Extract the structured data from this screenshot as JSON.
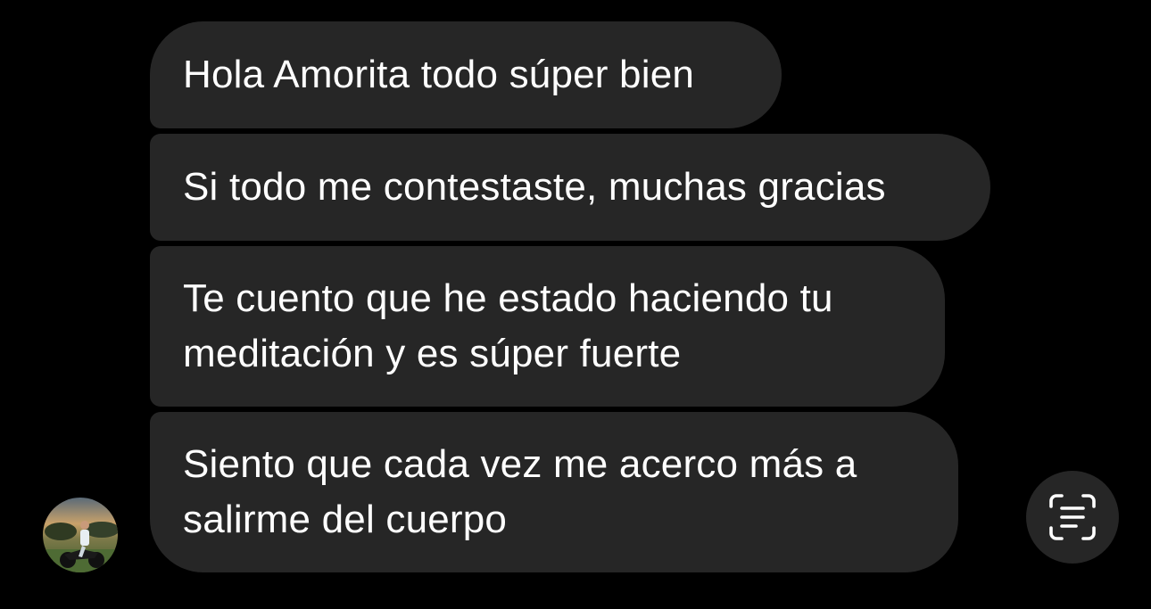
{
  "conversation": {
    "messages": [
      {
        "sender": "contact",
        "text": "Hola Amorita todo súper bien"
      },
      {
        "sender": "contact",
        "text": "Si todo me contestaste, muchas gracias"
      },
      {
        "sender": "contact",
        "text": "Te cuento que he estado haciendo tu\nmeditación y es súper fuerte"
      },
      {
        "sender": "contact",
        "text": "Siento que cada vez me acerco más a\nsalirme del cuerpo"
      }
    ]
  },
  "avatar": {
    "icon": "contact-avatar-photo"
  },
  "live_text_button": {
    "icon": "text-scan-icon"
  },
  "colors": {
    "background": "#000000",
    "bubble": "#262626",
    "text": "#ffffff"
  }
}
